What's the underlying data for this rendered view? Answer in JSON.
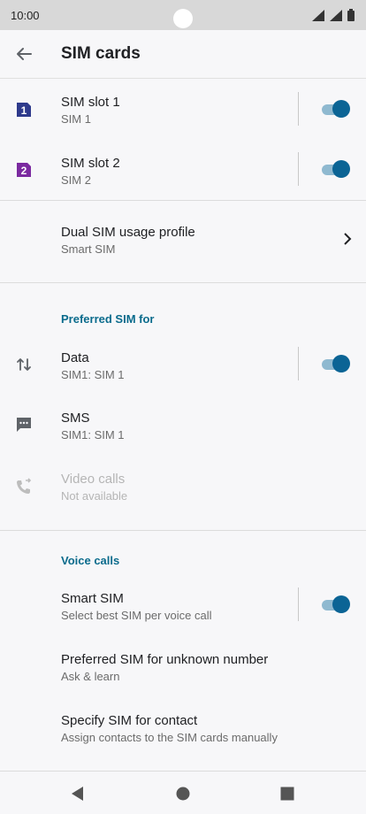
{
  "status_bar": {
    "time": "10:00"
  },
  "app_bar": {
    "title": "SIM cards"
  },
  "sim_slots": [
    {
      "title": "SIM slot 1",
      "subtitle": "SIM 1",
      "badge": "1",
      "badge_color": "#2e3a8c",
      "enabled": true
    },
    {
      "title": "SIM slot 2",
      "subtitle": "SIM 2",
      "badge": "2",
      "badge_color": "#7b2aa0",
      "enabled": true
    }
  ],
  "dual_sim": {
    "title": "Dual SIM usage profile",
    "subtitle": "Smart SIM"
  },
  "preferred": {
    "heading": "Preferred SIM for",
    "data": {
      "title": "Data",
      "subtitle": "SIM1: SIM 1",
      "enabled": true
    },
    "sms": {
      "title": "SMS",
      "subtitle": "SIM1: SIM 1"
    },
    "video": {
      "title": "Video calls",
      "subtitle": "Not available",
      "disabled": true
    }
  },
  "voice": {
    "heading": "Voice calls",
    "smart_sim": {
      "title": "Smart SIM",
      "subtitle": "Select best SIM per voice call",
      "enabled": true
    },
    "unknown": {
      "title": "Preferred SIM for unknown number",
      "subtitle": "Ask & learn"
    },
    "contact": {
      "title": "Specify SIM for contact",
      "subtitle": "Assign contacts to the SIM cards manually"
    }
  },
  "colors": {
    "accent": "#0b6495",
    "section_heading": "#0a6b8c"
  },
  "icons": {
    "back": "arrow-back-icon",
    "data": "swap-vertical-icon",
    "sms": "message-icon",
    "video": "phone-forward-icon",
    "chevron": "chevron-right-icon"
  }
}
